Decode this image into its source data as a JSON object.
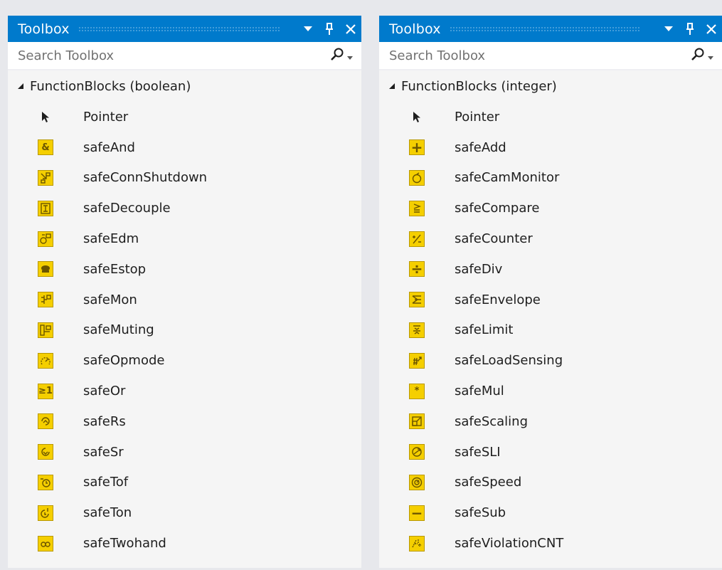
{
  "panels": [
    {
      "title": "Toolbox",
      "search_placeholder": "Search Toolbox",
      "group": "FunctionBlocks (boolean)",
      "items": [
        {
          "label": "Pointer",
          "icon": "pointer-icon"
        },
        {
          "label": "safeAnd",
          "icon": "and-block-icon",
          "glyph": "&"
        },
        {
          "label": "safeConnShutdown",
          "icon": "conn-shutdown-block-icon"
        },
        {
          "label": "safeDecouple",
          "icon": "decouple-block-icon"
        },
        {
          "label": "safeEdm",
          "icon": "edm-block-icon"
        },
        {
          "label": "safeEstop",
          "icon": "estop-block-icon"
        },
        {
          "label": "safeMon",
          "icon": "mon-block-icon"
        },
        {
          "label": "safeMuting",
          "icon": "muting-block-icon"
        },
        {
          "label": "safeOpmode",
          "icon": "opmode-block-icon"
        },
        {
          "label": "safeOr",
          "icon": "or-block-icon",
          "glyph": "≥1"
        },
        {
          "label": "safeRs",
          "icon": "rs-block-icon"
        },
        {
          "label": "safeSr",
          "icon": "sr-block-icon"
        },
        {
          "label": "safeTof",
          "icon": "tof-block-icon"
        },
        {
          "label": "safeTon",
          "icon": "ton-block-icon"
        },
        {
          "label": "safeTwohand",
          "icon": "twohand-block-icon"
        }
      ]
    },
    {
      "title": "Toolbox",
      "search_placeholder": "Search Toolbox",
      "group": "FunctionBlocks (integer)",
      "items": [
        {
          "label": "Pointer",
          "icon": "pointer-icon"
        },
        {
          "label": "safeAdd",
          "icon": "add-block-icon",
          "glyph": "+"
        },
        {
          "label": "safeCamMonitor",
          "icon": "cam-monitor-block-icon"
        },
        {
          "label": "safeCompare",
          "icon": "compare-block-icon"
        },
        {
          "label": "safeCounter",
          "icon": "counter-block-icon"
        },
        {
          "label": "safeDiv",
          "icon": "div-block-icon",
          "glyph": "÷"
        },
        {
          "label": "safeEnvelope",
          "icon": "envelope-block-icon"
        },
        {
          "label": "safeLimit",
          "icon": "limit-block-icon"
        },
        {
          "label": "safeLoadSensing",
          "icon": "load-sensing-block-icon"
        },
        {
          "label": "safeMul",
          "icon": "mul-block-icon",
          "glyph": "*"
        },
        {
          "label": "safeScaling",
          "icon": "scaling-block-icon"
        },
        {
          "label": "safeSLI",
          "icon": "sli-block-icon"
        },
        {
          "label": "safeSpeed",
          "icon": "speed-block-icon"
        },
        {
          "label": "safeSub",
          "icon": "sub-block-icon",
          "glyph": "−"
        },
        {
          "label": "safeViolationCNT",
          "icon": "violation-cnt-block-icon"
        }
      ]
    }
  ],
  "colors": {
    "titlebar": "#007acc",
    "block_icon": "#f5cf00",
    "panel_bg": "#f5f5f5"
  }
}
